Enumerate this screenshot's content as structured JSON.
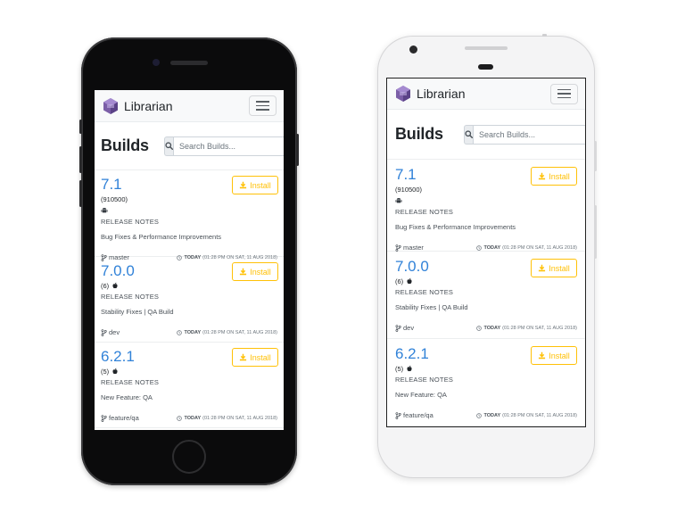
{
  "app": {
    "brand_name": "Librarian",
    "page_title": "Builds",
    "search_placeholder": "Search Builds...",
    "install_label": "Install",
    "notes_heading": "RELEASE NOTES"
  },
  "colors": {
    "version_link": "#3182d8",
    "install_accent": "#ffc107",
    "logo_purple": "#7b5ea7"
  },
  "builds": [
    {
      "version": "7.1",
      "build_number": "(910500)",
      "platform": "android",
      "notes": "Bug Fixes & Performance Improvements",
      "branch": "master",
      "date_bold": "TODAY",
      "date_rest": "(01:28 PM ON SAT, 11 AUG 2018)"
    },
    {
      "version": "7.0.0",
      "build_number": "(6)",
      "platform": "apple",
      "notes": "Stability Fixes | QA Build",
      "branch": "dev",
      "date_bold": "TODAY",
      "date_rest": "(01:28 PM ON SAT, 11 AUG 2018)"
    },
    {
      "version": "6.2.1",
      "build_number": "(5)",
      "platform": "apple",
      "notes": "New Feature: QA",
      "branch": "feature/qa",
      "date_bold": "TODAY",
      "date_rest": "(01:28 PM ON SAT, 11 AUG 2018)"
    }
  ]
}
